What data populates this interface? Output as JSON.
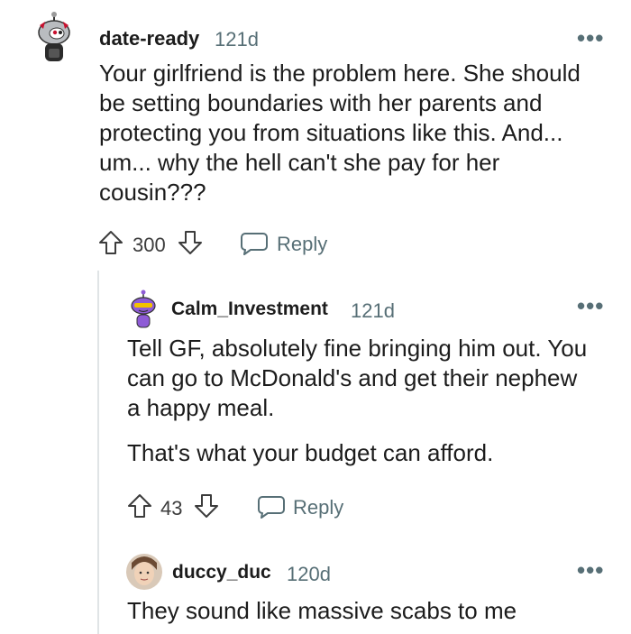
{
  "comments": [
    {
      "username": "date-ready",
      "age": "121d",
      "text": "Your girlfriend is the problem here. She should be setting boundaries with her parents and protecting you from situations like this. And... um... why the hell can't she pay for her cousin???",
      "votes": "300",
      "reply_label": "Reply",
      "more": "•••"
    },
    {
      "username": "Calm_Investment",
      "age": "121d",
      "paragraphs": [
        "Tell GF, absolutely fine bringing him out. You can go to McDonald's and get their nephew a happy meal.",
        "That's what your budget can afford."
      ],
      "votes": "43",
      "reply_label": "Reply",
      "more": "•••"
    },
    {
      "username": "duccy_duc",
      "age": "120d",
      "text": "They sound like massive scabs to me",
      "more": "•••"
    }
  ]
}
